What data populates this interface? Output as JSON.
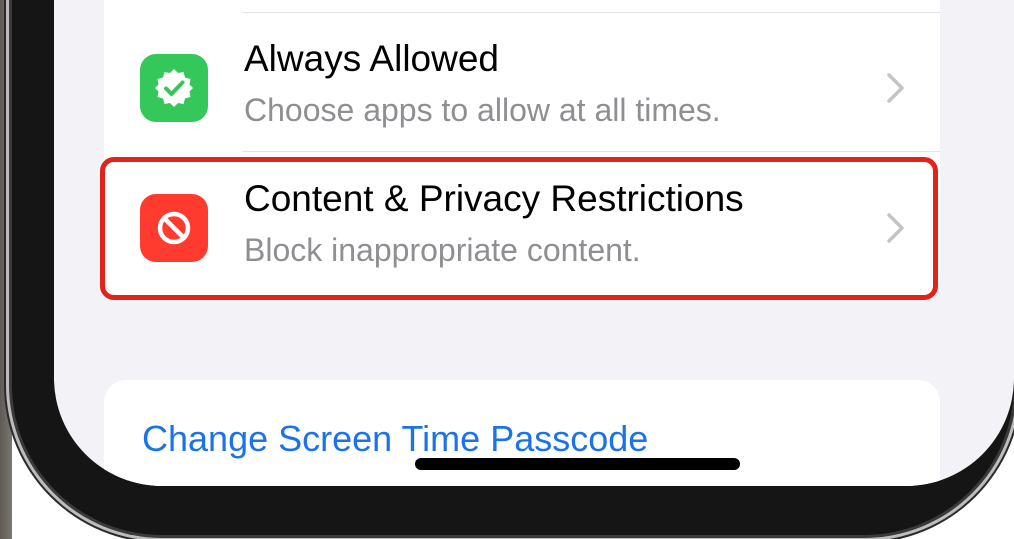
{
  "settings": {
    "rows": [
      {
        "title": "Always Allowed",
        "subtitle": "Choose apps to allow at all times.",
        "icon": "checkmark-seal-icon",
        "icon_color": "#34c759"
      },
      {
        "title": "Content & Privacy Restrictions",
        "subtitle": "Block inappropriate content.",
        "icon": "no-entry-icon",
        "icon_color": "#ff3b30",
        "highlighted": true,
        "highlight_color": "#e2231a"
      }
    ],
    "passcode_link": "Change Screen Time Passcode",
    "link_color": "#1a73e8",
    "background_color": "#f2f2f7"
  }
}
